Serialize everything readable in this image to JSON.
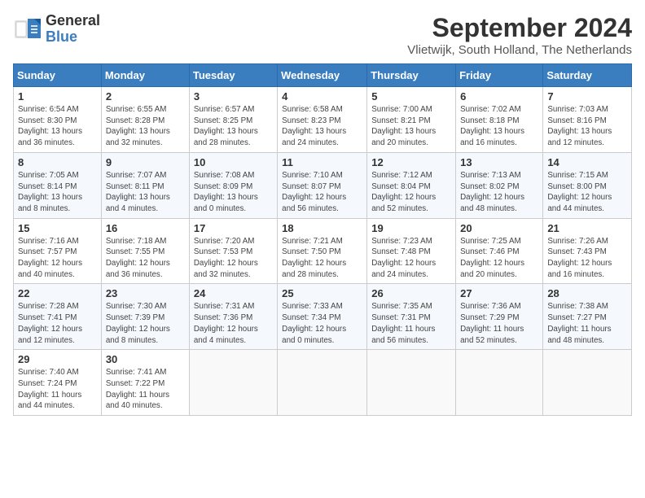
{
  "header": {
    "logo_general": "General",
    "logo_blue": "Blue",
    "title": "September 2024",
    "location": "Vlietwijk, South Holland, The Netherlands"
  },
  "weekdays": [
    "Sunday",
    "Monday",
    "Tuesday",
    "Wednesday",
    "Thursday",
    "Friday",
    "Saturday"
  ],
  "weeks": [
    [
      {
        "day": "1",
        "info": "Sunrise: 6:54 AM\nSunset: 8:30 PM\nDaylight: 13 hours\nand 36 minutes."
      },
      {
        "day": "2",
        "info": "Sunrise: 6:55 AM\nSunset: 8:28 PM\nDaylight: 13 hours\nand 32 minutes."
      },
      {
        "day": "3",
        "info": "Sunrise: 6:57 AM\nSunset: 8:25 PM\nDaylight: 13 hours\nand 28 minutes."
      },
      {
        "day": "4",
        "info": "Sunrise: 6:58 AM\nSunset: 8:23 PM\nDaylight: 13 hours\nand 24 minutes."
      },
      {
        "day": "5",
        "info": "Sunrise: 7:00 AM\nSunset: 8:21 PM\nDaylight: 13 hours\nand 20 minutes."
      },
      {
        "day": "6",
        "info": "Sunrise: 7:02 AM\nSunset: 8:18 PM\nDaylight: 13 hours\nand 16 minutes."
      },
      {
        "day": "7",
        "info": "Sunrise: 7:03 AM\nSunset: 8:16 PM\nDaylight: 13 hours\nand 12 minutes."
      }
    ],
    [
      {
        "day": "8",
        "info": "Sunrise: 7:05 AM\nSunset: 8:14 PM\nDaylight: 13 hours\nand 8 minutes."
      },
      {
        "day": "9",
        "info": "Sunrise: 7:07 AM\nSunset: 8:11 PM\nDaylight: 13 hours\nand 4 minutes."
      },
      {
        "day": "10",
        "info": "Sunrise: 7:08 AM\nSunset: 8:09 PM\nDaylight: 13 hours\nand 0 minutes."
      },
      {
        "day": "11",
        "info": "Sunrise: 7:10 AM\nSunset: 8:07 PM\nDaylight: 12 hours\nand 56 minutes."
      },
      {
        "day": "12",
        "info": "Sunrise: 7:12 AM\nSunset: 8:04 PM\nDaylight: 12 hours\nand 52 minutes."
      },
      {
        "day": "13",
        "info": "Sunrise: 7:13 AM\nSunset: 8:02 PM\nDaylight: 12 hours\nand 48 minutes."
      },
      {
        "day": "14",
        "info": "Sunrise: 7:15 AM\nSunset: 8:00 PM\nDaylight: 12 hours\nand 44 minutes."
      }
    ],
    [
      {
        "day": "15",
        "info": "Sunrise: 7:16 AM\nSunset: 7:57 PM\nDaylight: 12 hours\nand 40 minutes."
      },
      {
        "day": "16",
        "info": "Sunrise: 7:18 AM\nSunset: 7:55 PM\nDaylight: 12 hours\nand 36 minutes."
      },
      {
        "day": "17",
        "info": "Sunrise: 7:20 AM\nSunset: 7:53 PM\nDaylight: 12 hours\nand 32 minutes."
      },
      {
        "day": "18",
        "info": "Sunrise: 7:21 AM\nSunset: 7:50 PM\nDaylight: 12 hours\nand 28 minutes."
      },
      {
        "day": "19",
        "info": "Sunrise: 7:23 AM\nSunset: 7:48 PM\nDaylight: 12 hours\nand 24 minutes."
      },
      {
        "day": "20",
        "info": "Sunrise: 7:25 AM\nSunset: 7:46 PM\nDaylight: 12 hours\nand 20 minutes."
      },
      {
        "day": "21",
        "info": "Sunrise: 7:26 AM\nSunset: 7:43 PM\nDaylight: 12 hours\nand 16 minutes."
      }
    ],
    [
      {
        "day": "22",
        "info": "Sunrise: 7:28 AM\nSunset: 7:41 PM\nDaylight: 12 hours\nand 12 minutes."
      },
      {
        "day": "23",
        "info": "Sunrise: 7:30 AM\nSunset: 7:39 PM\nDaylight: 12 hours\nand 8 minutes."
      },
      {
        "day": "24",
        "info": "Sunrise: 7:31 AM\nSunset: 7:36 PM\nDaylight: 12 hours\nand 4 minutes."
      },
      {
        "day": "25",
        "info": "Sunrise: 7:33 AM\nSunset: 7:34 PM\nDaylight: 12 hours\nand 0 minutes."
      },
      {
        "day": "26",
        "info": "Sunrise: 7:35 AM\nSunset: 7:31 PM\nDaylight: 11 hours\nand 56 minutes."
      },
      {
        "day": "27",
        "info": "Sunrise: 7:36 AM\nSunset: 7:29 PM\nDaylight: 11 hours\nand 52 minutes."
      },
      {
        "day": "28",
        "info": "Sunrise: 7:38 AM\nSunset: 7:27 PM\nDaylight: 11 hours\nand 48 minutes."
      }
    ],
    [
      {
        "day": "29",
        "info": "Sunrise: 7:40 AM\nSunset: 7:24 PM\nDaylight: 11 hours\nand 44 minutes."
      },
      {
        "day": "30",
        "info": "Sunrise: 7:41 AM\nSunset: 7:22 PM\nDaylight: 11 hours\nand 40 minutes."
      },
      null,
      null,
      null,
      null,
      null
    ]
  ]
}
